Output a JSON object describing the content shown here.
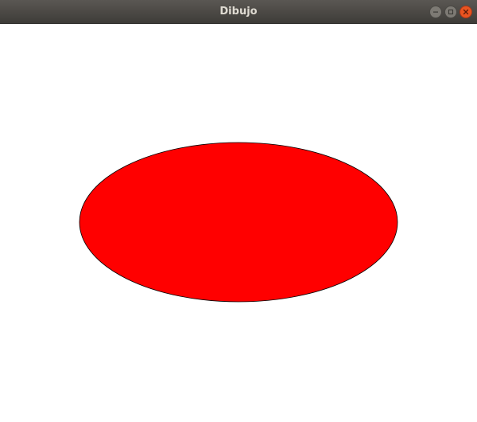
{
  "window": {
    "title": "Dibujo",
    "controls": {
      "minimize_icon": "minimize-icon",
      "maximize_icon": "maximize-icon",
      "close_icon": "close-icon"
    }
  },
  "drawing": {
    "shape": "ellipse",
    "fill": "#ff0000",
    "stroke": "#000000"
  }
}
